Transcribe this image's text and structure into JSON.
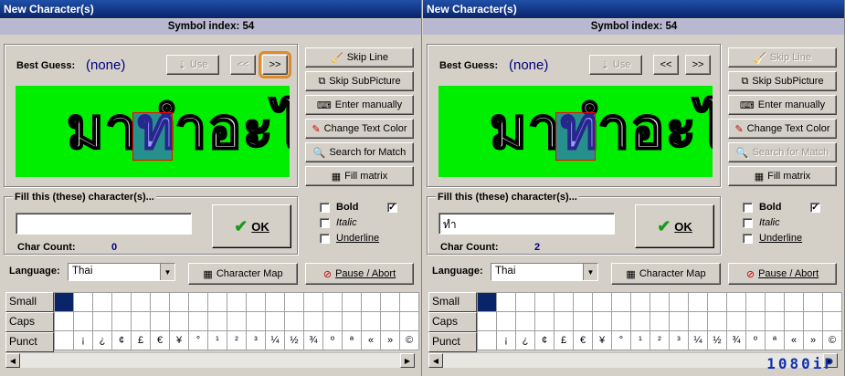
{
  "windows": [
    {
      "title": "New Character(s)",
      "symbol_index_label": "Symbol index: 54",
      "best_guess_label": "Best Guess:",
      "best_guess_value": "(none)",
      "use_label": "Use",
      "prev_label": "<<",
      "next_label": ">>",
      "skip_line": "Skip Line",
      "skip_subpicture": "Skip SubPicture",
      "enter_manually": "Enter manually",
      "change_text_color": "Change Text Color",
      "search_for_match": "Search for Match",
      "fill_matrix": "Fill matrix",
      "preview_text": "มาทำอะไ",
      "fill_group_label": "Fill this (these) character(s)...",
      "input_value": "",
      "char_count_label": "Char Count:",
      "char_count": "0",
      "ok_label": "OK",
      "bold_label": "Bold",
      "italic_label": "Italic",
      "underline_label": "Underline",
      "bold_checked": false,
      "extra_checked": true,
      "language_label": "Language:",
      "language_value": "Thai",
      "character_map": "Character Map",
      "pause_abort": "Pause / Abort",
      "rows": [
        "Small",
        "Caps",
        "Punct"
      ],
      "punct": [
        "¡",
        "¿",
        "¢",
        "£",
        "€",
        "¥",
        "°",
        "¹",
        "²",
        "³",
        "¼",
        "½",
        "¾",
        "º",
        "ª",
        "«",
        "»",
        "©"
      ],
      "search_disabled": false,
      "skip_line_disabled": false
    },
    {
      "title": "New Character(s)",
      "symbol_index_label": "Symbol index: 54",
      "best_guess_label": "Best Guess:",
      "best_guess_value": "(none)",
      "use_label": "Use",
      "prev_label": "<<",
      "next_label": ">>",
      "skip_line": "Skip Line",
      "skip_subpicture": "Skip SubPicture",
      "enter_manually": "Enter manually",
      "change_text_color": "Change Text Color",
      "search_for_match": "Search for Match",
      "fill_matrix": "Fill matrix",
      "preview_text": "มาทำอะไ",
      "fill_group_label": "Fill this (these) character(s)...",
      "input_value": "ทำ",
      "char_count_label": "Char Count:",
      "char_count": "2",
      "ok_label": "OK",
      "bold_label": "Bold",
      "italic_label": "Italic",
      "underline_label": "Underline",
      "bold_checked": false,
      "extra_checked": true,
      "language_label": "Language:",
      "language_value": "Thai",
      "character_map": "Character Map",
      "pause_abort": "Pause / Abort",
      "rows": [
        "Small",
        "Caps",
        "Punct"
      ],
      "punct": [
        "¡",
        "¿",
        "¢",
        "£",
        "€",
        "¥",
        "°",
        "¹",
        "²",
        "³",
        "¼",
        "½",
        "¾",
        "º",
        "ª",
        "«",
        "»",
        "©"
      ],
      "search_disabled": true,
      "skip_line_disabled": true
    }
  ],
  "watermark": "1080iP"
}
